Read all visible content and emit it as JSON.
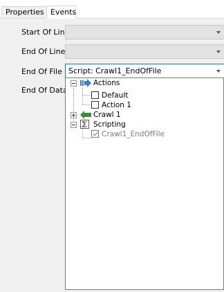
{
  "tabs": [
    {
      "label": "Properties",
      "active": false
    },
    {
      "label": "Events",
      "active": true
    }
  ],
  "events": {
    "start_of_line": {
      "label": "Start Of Line",
      "value": ""
    },
    "end_of_line": {
      "label": "End Of Line",
      "value": ""
    },
    "end_of_file": {
      "label": "End Of File",
      "value": "Script: Crawl1_EndOfFile"
    },
    "end_of_data": {
      "label": "End Of Data"
    }
  },
  "tree": {
    "actions": {
      "label": "Actions",
      "expanded": true,
      "icon": "arrow-right-blue-icon"
    },
    "default": {
      "label": "Default",
      "checked": false
    },
    "action1": {
      "label": "Action 1",
      "checked": false
    },
    "crawl1": {
      "label": "Crawl 1",
      "expanded": false,
      "icon": "arrow-left-green-icon"
    },
    "scripting": {
      "label": "Scripting",
      "expanded": true,
      "icon": "sigma-script-icon"
    },
    "crawl1_endoffile": {
      "label": "Crawl1_EndOfFile",
      "checked": true,
      "disabled": true
    }
  },
  "colors": {
    "panel_bg": "#f0f0f0",
    "focus_border": "#0078d7",
    "actions_icon": "#2f7fe0",
    "crawl_icon": "#3a8c3a"
  }
}
